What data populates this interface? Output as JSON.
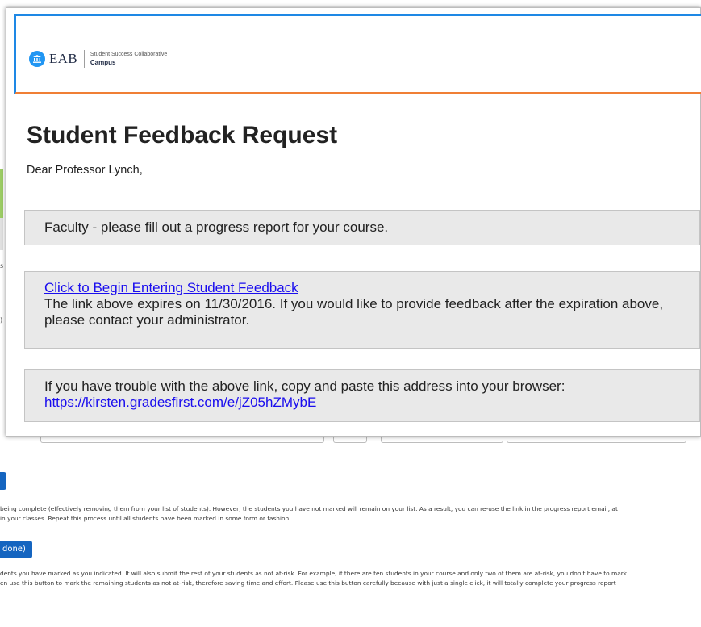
{
  "email": {
    "logo": {
      "word": "EAB",
      "line1": "Student Success Collaborative",
      "line2": "Campus"
    },
    "title": "Student Feedback Request",
    "greeting": "Dear Professor Lynch,",
    "box1_text": "Faculty - please fill out a progress report for your course.",
    "box2": {
      "link_text": "Click to Begin Entering Student Feedback",
      "expiry_line": "The link above expires on 11/30/2016. If you would like to provide feedback after the expiration above, please contact your administrator."
    },
    "box3": {
      "instruction": "If you have trouble with the above link, copy and paste this address into your browser:",
      "url": "https://kirsten.gradesfirst.com/e/jZ05hZMybE"
    }
  },
  "background": {
    "button_done": "done)",
    "paragraph1_line1": "being complete (effectively removing them from your list of students). However, the students you have not marked will remain on your list. As a result, you can re-use the link in the progress report email, at",
    "paragraph1_line2": "in your classes. Repeat this process until all students have been marked in some form or fashion.",
    "paragraph2_line1": "dents you have marked as you indicated. It will also submit the rest of your students as not at-risk. For example, if there are ten students in your course and only two of them are at-risk, you don't have to mark",
    "paragraph2_line2": "en use this button to mark the remaining students as not at-risk, therefore saving time and effort. Please use this button carefully because with just a single click, it will totally complete your progress report"
  },
  "colors": {
    "header_top_border": "#1e88e5",
    "header_bottom_border": "#f07f35",
    "link": "#1a0dee",
    "button": "#1565c0"
  }
}
